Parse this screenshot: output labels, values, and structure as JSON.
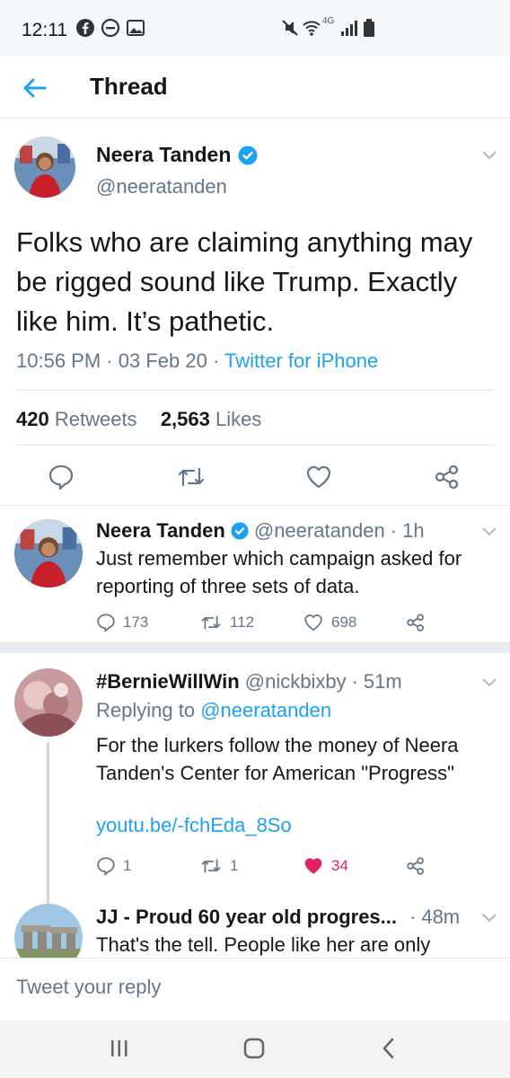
{
  "status_bar": {
    "time": "12:11",
    "network_label": "4G",
    "icons": [
      "facebook-icon",
      "dnd-icon",
      "gallery-icon",
      "mute-icon",
      "wifi-icon",
      "signal-icon",
      "battery-icon"
    ]
  },
  "header": {
    "title": "Thread"
  },
  "main_tweet": {
    "display_name": "Neera Tanden",
    "handle": "@neeratanden",
    "text": "Folks who are claiming anything may be rigged sound like Trump. Exactly like him. It’s pathetic.",
    "time": "10:56 PM",
    "date": "03 Feb 20",
    "source": "Twitter for iPhone",
    "retweets_count": "420",
    "retweets_label": "Retweets",
    "likes_count": "2,563",
    "likes_label": "Likes"
  },
  "reply1": {
    "display_name": "Neera Tanden",
    "handle": "@neeratanden",
    "time_ago": "1h",
    "text": "Just remember which campaign asked for reporting of three sets of data.",
    "replies": "173",
    "retweets": "112",
    "likes": "698"
  },
  "reply2": {
    "display_name": "#BernieWillWin",
    "handle": "@nickbixby",
    "time_ago": "51m",
    "replying_label": "Replying to",
    "replying_to": "@neeratanden",
    "text": "For the lurkers follow the money of Neera Tanden's Center for American \"Progress\"",
    "link": "youtu.be/-fchEda_8So",
    "replies": "1",
    "retweets": "1",
    "likes": "34"
  },
  "reply3": {
    "display_name": "JJ - Proud 60 year old progres...",
    "time_ago": "48m",
    "text": "That's the tell. People like her are only"
  },
  "compose": {
    "placeholder": "Tweet your reply"
  },
  "nav_bar": {
    "buttons": [
      "recents-button",
      "home-button",
      "back-button"
    ]
  },
  "colors": {
    "accent": "#1da1f2",
    "verified": "#1da1f2",
    "like_active": "#e0245e",
    "text_secondary": "#657786"
  }
}
